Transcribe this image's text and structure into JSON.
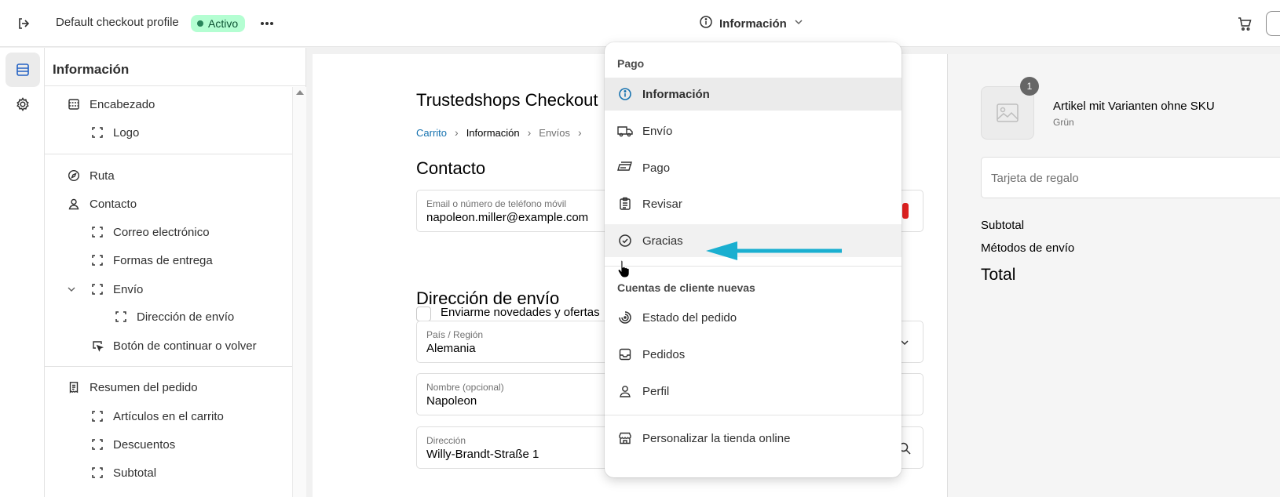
{
  "topbar": {
    "exit_icon": "exit-icon",
    "profile_name": "Default checkout profile",
    "status_badge": "Activo",
    "more_icon": "more-icon",
    "page_selector": "Información",
    "cart_icon": "cart-icon"
  },
  "rail": [
    {
      "icon": "sections-icon",
      "active": true
    },
    {
      "icon": "settings-icon",
      "active": false
    }
  ],
  "sidebar": {
    "title": "Información",
    "items": [
      {
        "label": "Encabezado",
        "icon": "header-icon"
      },
      {
        "label": "Logo",
        "icon": "block-icon"
      },
      {
        "label": "Ruta",
        "icon": "compass-icon"
      },
      {
        "label": "Contacto",
        "icon": "person-icon"
      },
      {
        "label": "Correo electrónico",
        "icon": "block-icon"
      },
      {
        "label": "Formas de entrega",
        "icon": "block-icon"
      },
      {
        "label": "Envío",
        "icon": "block-icon",
        "expanded": true
      },
      {
        "label": "Dirección de envío",
        "icon": "block-icon"
      },
      {
        "label": "Botón de continuar o volver",
        "icon": "cursor-box-icon"
      },
      {
        "label": "Resumen del pedido",
        "icon": "receipt-icon"
      },
      {
        "label": "Artículos en el carrito",
        "icon": "block-icon"
      },
      {
        "label": "Descuentos",
        "icon": "block-icon"
      },
      {
        "label": "Subtotal",
        "icon": "block-icon"
      }
    ]
  },
  "checkout": {
    "store_title": "Trustedshops Checkout",
    "breadcrumbs": {
      "cart": "Carrito",
      "info": "Información",
      "shipping": "Envíos"
    },
    "contact_heading": "Contacto",
    "email_label": "Email o número de teléfono móvil",
    "email_value": "napoleon.miller@example.com",
    "newsletter_label": "Enviarme novedades y ofertas",
    "address_heading": "Dirección de envío",
    "country_label": "País / Región",
    "country_value": "Alemania",
    "name_label": "Nombre (opcional)",
    "name_value": "Napoleon",
    "address_label": "Dirección",
    "address_value": "Willy-Brandt-Straße 1"
  },
  "summary": {
    "quantity": "1",
    "product_name": "Artikel mit Varianten ohne SKU",
    "product_variant": "Grün",
    "gift_card_placeholder": "Tarjeta de regalo",
    "subtotal_label": "Subtotal",
    "shipping_label": "Métodos de envío",
    "total_label": "Total"
  },
  "menu": {
    "group1": "Pago",
    "items1": [
      {
        "label": "Información",
        "icon": "info-icon",
        "state": "selected"
      },
      {
        "label": "Envío",
        "icon": "truck-icon",
        "state": ""
      },
      {
        "label": "Pago",
        "icon": "payment-icon",
        "state": ""
      },
      {
        "label": "Revisar",
        "icon": "clipboard-icon",
        "state": ""
      },
      {
        "label": "Gracias",
        "icon": "check-circle-icon",
        "state": "hover"
      }
    ],
    "group2": "Cuentas de cliente nuevas",
    "items2": [
      {
        "label": "Estado del pedido",
        "icon": "order-status-icon"
      },
      {
        "label": "Pedidos",
        "icon": "inbox-icon"
      },
      {
        "label": "Perfil",
        "icon": "person-icon"
      }
    ],
    "footer_item": {
      "label": "Personalizar la tienda online",
      "icon": "store-icon"
    }
  },
  "colors": {
    "accent": "#1773b0",
    "badge_bg": "#b4fed2",
    "badge_text": "#0c5132",
    "annotation_arrow": "#1aafd0"
  }
}
